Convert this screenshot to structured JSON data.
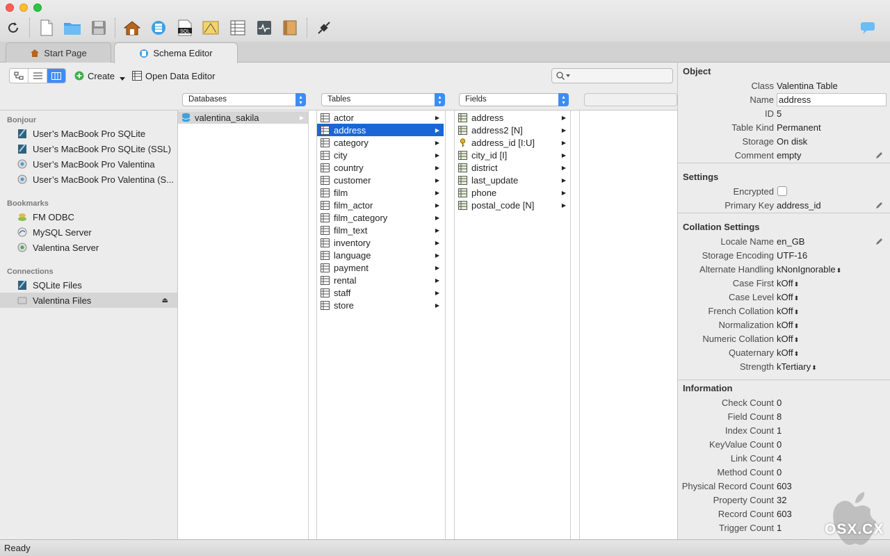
{
  "toolbar": {
    "buttons": [
      "refresh-icon",
      "new-file-icon",
      "open-folder-icon",
      "save-icon",
      "home-icon",
      "schema-icon",
      "sql-icon",
      "report-icon",
      "table-icon",
      "monitor-icon",
      "book-icon",
      "plug-icon",
      "chat-icon"
    ]
  },
  "tabs": [
    {
      "label": "Start Page",
      "active": false
    },
    {
      "label": "Schema Editor",
      "active": true
    }
  ],
  "editor_toolbar": {
    "create_label": "Create",
    "open_data_editor_label": "Open Data Editor"
  },
  "columns": {
    "databases_header": "Databases",
    "tables_header": "Tables",
    "fields_header": "Fields"
  },
  "sidebar": {
    "sections": [
      {
        "title": "Bonjour",
        "items": [
          {
            "label": "User’s MacBook Pro SQLite",
            "icon": "sqlite-icon"
          },
          {
            "label": "User’s MacBook Pro SQLite (SSL)",
            "icon": "sqlite-icon"
          },
          {
            "label": "User’s MacBook Pro Valentina",
            "icon": "valentina-server-icon"
          },
          {
            "label": "User’s MacBook Pro Valentina (S...",
            "icon": "valentina-server-icon"
          }
        ]
      },
      {
        "title": "Bookmarks",
        "items": [
          {
            "label": "FM ODBC",
            "icon": "odbc-icon"
          },
          {
            "label": "MySQL Server",
            "icon": "mysql-icon"
          },
          {
            "label": "Valentina Server",
            "icon": "valentina-server-icon"
          }
        ]
      },
      {
        "title": "Connections",
        "items": [
          {
            "label": "SQLite Files",
            "icon": "sqlite-icon"
          },
          {
            "label": "Valentina Files",
            "icon": "valentina-file-icon",
            "selected": true
          }
        ]
      }
    ]
  },
  "databases": [
    {
      "label": "valentina_sakila",
      "selected": true
    }
  ],
  "tables": [
    {
      "label": "actor"
    },
    {
      "label": "address",
      "selected": true
    },
    {
      "label": "category"
    },
    {
      "label": "city"
    },
    {
      "label": "country"
    },
    {
      "label": "customer"
    },
    {
      "label": "film"
    },
    {
      "label": "film_actor"
    },
    {
      "label": "film_category"
    },
    {
      "label": "film_text"
    },
    {
      "label": "inventory"
    },
    {
      "label": "language"
    },
    {
      "label": "payment"
    },
    {
      "label": "rental"
    },
    {
      "label": "staff"
    },
    {
      "label": "store"
    }
  ],
  "fields": [
    {
      "label": "address",
      "icon": "field-icon"
    },
    {
      "label": "address2 [N]",
      "icon": "field-icon"
    },
    {
      "label": "address_id [I:U]",
      "icon": "key-icon"
    },
    {
      "label": "city_id [I]",
      "icon": "field-icon"
    },
    {
      "label": "district",
      "icon": "field-icon"
    },
    {
      "label": "last_update",
      "icon": "field-icon"
    },
    {
      "label": "phone",
      "icon": "field-icon"
    },
    {
      "label": "postal_code [N]",
      "icon": "field-icon"
    }
  ],
  "inspector": {
    "object": {
      "title": "Object",
      "rows": [
        {
          "key": "Class",
          "value": "Valentina Table"
        },
        {
          "key": "Name",
          "value": "address",
          "editable": true
        },
        {
          "key": "ID",
          "value": "5"
        },
        {
          "key": "Table Kind",
          "value": "Permanent"
        },
        {
          "key": "Storage",
          "value": "On disk"
        },
        {
          "key": "Comment",
          "value": "empty",
          "pencil": true
        }
      ]
    },
    "settings": {
      "title": "Settings",
      "rows": [
        {
          "key": "Encrypted",
          "value": "",
          "checkbox": true
        },
        {
          "key": "Primary Key",
          "value": "address_id",
          "pencil": true
        }
      ]
    },
    "collation": {
      "title": "Collation Settings",
      "rows": [
        {
          "key": "Locale Name",
          "value": "en_GB",
          "pencil": true
        },
        {
          "key": "Storage Encoding",
          "value": "UTF-16"
        },
        {
          "key": "Alternate Handling",
          "value": "kNonIgnorable",
          "popup": true
        },
        {
          "key": "Case First",
          "value": "kOff",
          "popup": true
        },
        {
          "key": "Case Level",
          "value": "kOff",
          "popup": true
        },
        {
          "key": "French Collation",
          "value": "kOff",
          "popup": true
        },
        {
          "key": "Normalization",
          "value": "kOff",
          "popup": true
        },
        {
          "key": "Numeric Collation",
          "value": "kOff",
          "popup": true
        },
        {
          "key": "Quaternary",
          "value": "kOff",
          "popup": true
        },
        {
          "key": "Strength",
          "value": "kTertiary",
          "popup": true
        }
      ]
    },
    "information": {
      "title": "Information",
      "rows": [
        {
          "key": "Check Count",
          "value": "0"
        },
        {
          "key": "Field Count",
          "value": "8"
        },
        {
          "key": "Index Count",
          "value": "1"
        },
        {
          "key": "KeyValue Count",
          "value": "0"
        },
        {
          "key": "Link Count",
          "value": "4"
        },
        {
          "key": "Method Count",
          "value": "0"
        },
        {
          "key": "Physical Record Count",
          "value": "603"
        },
        {
          "key": "Property Count",
          "value": "32"
        },
        {
          "key": "Record Count",
          "value": "603"
        },
        {
          "key": "Trigger Count",
          "value": "1"
        }
      ]
    }
  },
  "status": {
    "text": "Ready"
  },
  "watermark": {
    "text": "OSX.CX"
  },
  "colors": {
    "selection_blue": "#1a66d6",
    "accent_blue": "#3b8df5",
    "sidebar_bg": "#ececec"
  }
}
